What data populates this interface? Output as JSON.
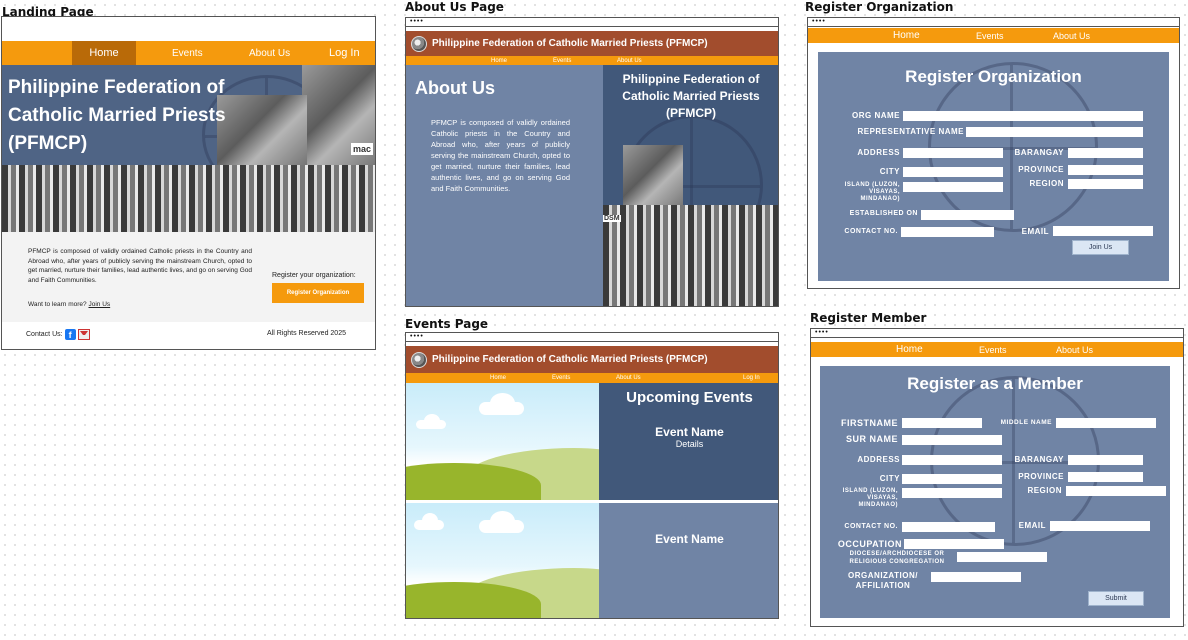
{
  "labels": {
    "landing": "Landing Page",
    "about": "About Us Page",
    "events": "Events Page",
    "register_org": "Register Organization",
    "register_member": "Register Member"
  },
  "window_dots": "••••",
  "colors": {
    "orange": "#f59a0d",
    "brown": "#a24d2d",
    "slate": "#7084a5",
    "navy": "#41587a"
  },
  "landing": {
    "nav": {
      "home": "Home",
      "events": "Events",
      "about": "About Us",
      "login": "Log In"
    },
    "hero_title": "Philippine Federation of Catholic Married Priests (PFMCP)",
    "hero_sign": "mac",
    "description": "PFMCP is composed of validly ordained Catholic priests in the Country and Abroad who, after years of publicly serving the mainstream Church, opted to get married, nurture their families, lead authentic lives, and go on serving God and Faith Communities.",
    "learn_more": "Want to learn more?",
    "join_us": "Join Us",
    "register_prompt": "Register your organization:",
    "register_button": "Register Organization",
    "contact": "Contact Us:",
    "rights": "All Rights Reserved 2025"
  },
  "about": {
    "banner": "Philippine Federation of Catholic Married Priests (PFMCP)",
    "nav": {
      "home": "Home",
      "events": "Events",
      "about": "About Us"
    },
    "heading": "About Us",
    "body": "PFMCP is composed of validly ordained Catholic priests in the Country and Abroad who, after years of publicly serving the mainstream Church, opted to get married, nurture their families, lead authentic lives, and go on serving God and Faith Communities.",
    "side_title": "Philippine Federation of Catholic Married Priests (PFMCP)",
    "photo_sign": "DSM"
  },
  "events": {
    "banner": "Philippine Federation of Catholic Married Priests (PFMCP)",
    "nav": {
      "home": "Home",
      "events": "Events",
      "about": "About Us",
      "login": "Log In"
    },
    "heading": "Upcoming Events",
    "event1_name": "Event Name",
    "event1_details": "Details",
    "event2_name": "Event Name"
  },
  "register_org": {
    "nav": {
      "home": "Home",
      "events": "Events",
      "about": "About Us"
    },
    "title": "Register Organization",
    "fields": {
      "org_name": "ORG NAME",
      "rep_name": "REPRESENTATIVE NAME",
      "address": "ADDRESS",
      "barangay": "BARANGAY",
      "city": "CITY",
      "province": "PROVINCE",
      "region": "REGION",
      "island": "ISLAND (LUZON, VISAYAS, MINDANAO)",
      "established": "ESTABLISHED ON",
      "contact": "CONTACT NO.",
      "email": "EMAIL"
    },
    "button": "Join Us"
  },
  "register_member": {
    "nav": {
      "home": "Home",
      "events": "Events",
      "about": "About Us"
    },
    "title": "Register as a Member",
    "fields": {
      "firstname": "FIRSTNAME",
      "middle": "MIDDLE NAME",
      "surname": "SUR NAME",
      "address": "ADDRESS",
      "barangay": "BARANGAY",
      "city": "CITY",
      "province": "PROVINCE",
      "region": "REGION",
      "island": "ISLAND (LUZON, VISAYAS, MINDANAO)",
      "contact": "CONTACT NO.",
      "email": "EMAIL",
      "occupation": "OCCUPATION",
      "diocese": "DIOCESE/ARCHDIOCESE OR RELIGIOUS CONGREGATION",
      "organization": "ORGANIZATION/ AFFILIATION"
    },
    "button": "Submit"
  }
}
